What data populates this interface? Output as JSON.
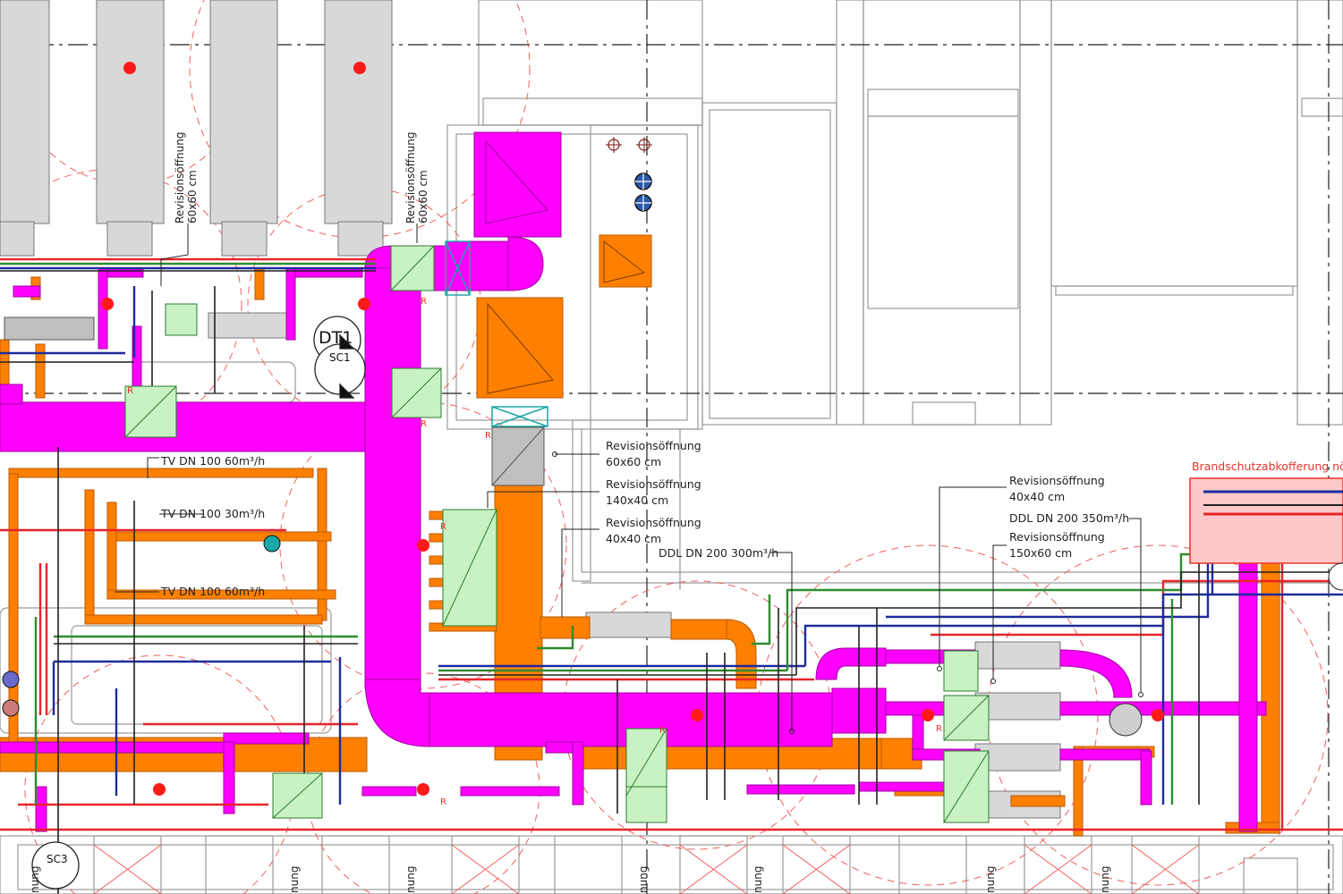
{
  "colors": {
    "supply_duct": "#ff00ff",
    "exhaust_duct": "#ff8000",
    "red_pipe": "#e8232a",
    "blue_pipe": "#1d2c9c",
    "green_pipe": "#2e8b2e",
    "cassette": "#d8d8d8",
    "fire_box": "#ffc8c8",
    "green_box": "#c8f2c4",
    "sprinkler": "#ff1a1a"
  },
  "tags": {
    "dt1": "DT1",
    "sc1": "SC1",
    "sc3": "SC3"
  },
  "fire_protection": "Brandschutzabkofferung nö",
  "annotations": [
    {
      "text": "Revisionsöffnung",
      "sub": "60x60 cm"
    },
    {
      "text": "Revisionsöffnung",
      "sub": "140x40 cm"
    },
    {
      "text": "Revisionsöffnung",
      "sub": "40x40 cm"
    },
    {
      "text": "DDL DN 200 300m³/h"
    },
    {
      "text": "Revisionsöffnung",
      "sub": "40x40 cm"
    },
    {
      "text": "DDL DN 200 350m³/h"
    },
    {
      "text": "Revisionsöffnung",
      "sub": "150x60 cm"
    },
    {
      "text": "TV DN 100 60m³/h"
    },
    {
      "text": "TV DN 100 30m³/h"
    },
    {
      "text": "TV DN 100 60m³/h"
    }
  ],
  "vertical_annotations": [
    {
      "text": "Revisionsöffnung",
      "sub": "60x60 cm"
    },
    {
      "text": "Revisionsöffnung",
      "sub": "60x60 cm"
    },
    {
      "text": "nung"
    },
    {
      "text": "nung"
    },
    {
      "text": "nung"
    },
    {
      "text": "nung"
    },
    {
      "text": "nung"
    },
    {
      "text": "nung"
    },
    {
      "text": "nung"
    }
  ],
  "duct_markers": [
    "R",
    "R",
    "R",
    "R",
    "R",
    "R",
    "R",
    "R"
  ]
}
